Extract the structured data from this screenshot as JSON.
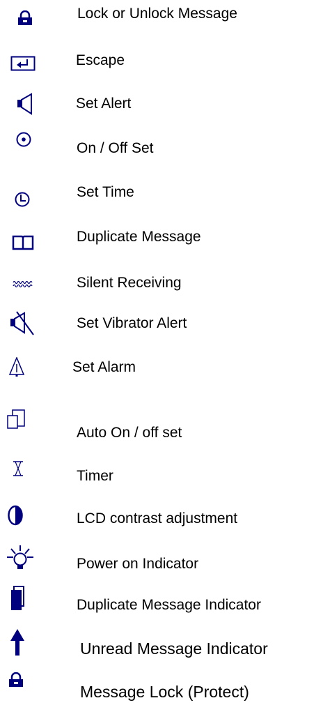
{
  "icon_color": "#00007f",
  "legend": [
    {
      "icon": "lock-icon",
      "label": "Lock or Unlock Message"
    },
    {
      "icon": "escape-icon",
      "label": "Escape"
    },
    {
      "icon": "speaker-icon",
      "label": "Set Alert"
    },
    {
      "icon": "on-off-icon",
      "label": "On / Off Set"
    },
    {
      "icon": "clock-icon",
      "label": "Set Time"
    },
    {
      "icon": "book-icon",
      "label": "Duplicate Message"
    },
    {
      "icon": "wave-icon",
      "label": "Silent Receiving"
    },
    {
      "icon": "speaker-muted-icon",
      "label": "Set Vibrator Alert"
    },
    {
      "icon": "bell-icon",
      "label": "Set Alarm"
    },
    {
      "icon": "auto-on-off-icon",
      "label": "Auto On / off set"
    },
    {
      "icon": "hourglass-icon",
      "label": "Timer"
    },
    {
      "icon": "contrast-icon",
      "label": "LCD contrast adjustment"
    },
    {
      "icon": "light-bulb-icon",
      "label": "Power on Indicator"
    },
    {
      "icon": "duplicate-indicator-icon",
      "label": "Duplicate Message Indicator"
    },
    {
      "icon": "up-arrow-icon",
      "label": "Unread Message Indicator"
    },
    {
      "icon": "lock-icon",
      "label": "Message Lock (Protect)"
    }
  ]
}
